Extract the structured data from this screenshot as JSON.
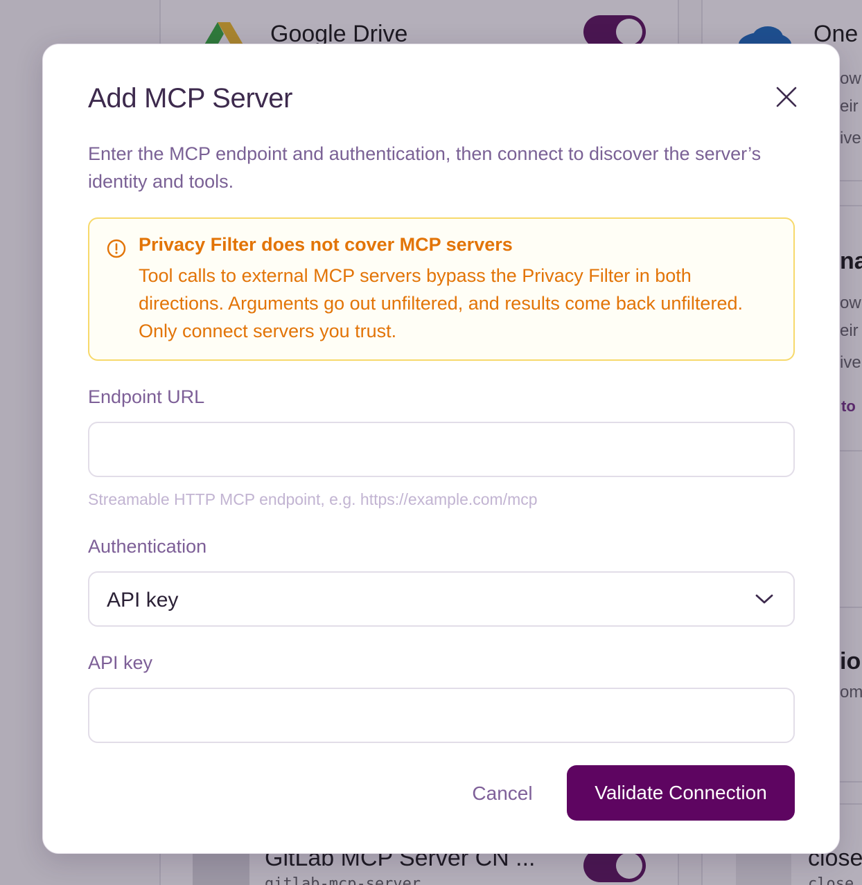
{
  "background": {
    "cards": [
      {
        "title": "Google Drive",
        "enabled": true
      },
      {
        "title": "One",
        "enabled": null
      },
      {
        "title": "GitLab MCP Server CN ...",
        "subtitle": "gitlab-mcp-server",
        "enabled": true
      },
      {
        "title": "close",
        "subtitle": "close"
      }
    ],
    "fragments": {
      "f1": "owi",
      "f2": "eir C",
      "f3": "ive",
      "f4": "nar",
      "f5": "owi",
      "f6": "eir S",
      "f7": "ive",
      "f8": "to",
      "f9": "ior",
      "f10": "om-"
    }
  },
  "modal": {
    "title": "Add MCP Server",
    "description": "Enter the MCP endpoint and authentication, then connect to discover the server’s identity and tools.",
    "alert": {
      "title": "Privacy Filter does not cover MCP servers",
      "body": "Tool calls to external MCP servers bypass the Privacy Filter in both directions. Arguments go out unfiltered, and results come back unfiltered. Only connect servers you trust.",
      "color": "#e27407",
      "border_color": "#f7d96b"
    },
    "endpoint": {
      "label": "Endpoint URL",
      "value": "",
      "hint": "Streamable HTTP MCP endpoint, e.g. https://example.com/mcp"
    },
    "authentication": {
      "label": "Authentication",
      "selected": "API key"
    },
    "api_key": {
      "label": "API key",
      "value": ""
    },
    "actions": {
      "cancel": "Cancel",
      "validate": "Validate Connection"
    },
    "colors": {
      "primary": "#5e0561",
      "title": "#3d2a4d",
      "muted": "#7a6195"
    }
  }
}
